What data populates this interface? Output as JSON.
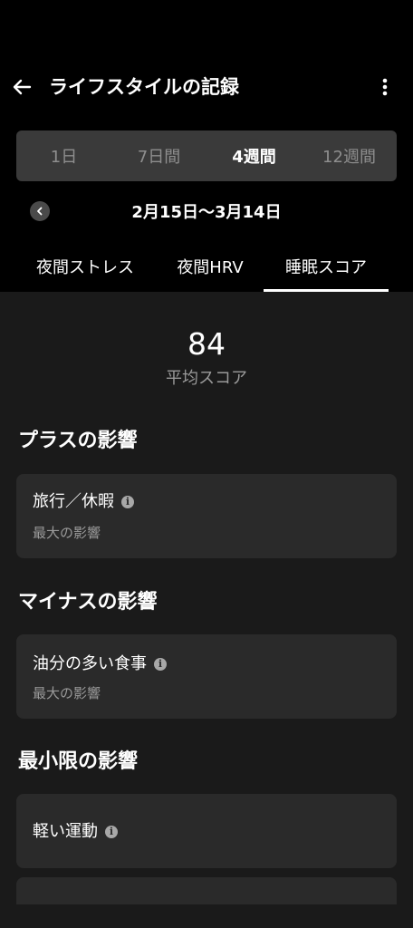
{
  "header": {
    "title": "ライフスタイルの記録",
    "back_icon": "arrow-left-icon",
    "more_icon": "more-vertical-icon"
  },
  "period_tabs": {
    "items": [
      {
        "label": "1日"
      },
      {
        "label": "7日間"
      },
      {
        "label": "4週間"
      },
      {
        "label": "12週間"
      }
    ],
    "selected": "4週間"
  },
  "date_nav": {
    "range": "2月15日〜3月14日",
    "prev_icon": "chevron-left-icon"
  },
  "metric_tabs": {
    "items": [
      {
        "label": "夜間ストレス"
      },
      {
        "label": "夜間HRV"
      },
      {
        "label": "睡眠スコア"
      }
    ],
    "selected": "睡眠スコア"
  },
  "score": {
    "value": "84",
    "label": "平均スコア"
  },
  "sections": [
    {
      "title": "プラスの影響",
      "cards": [
        {
          "title": "旅行／休暇",
          "subtitle": "最大の影響"
        }
      ]
    },
    {
      "title": "マイナスの影響",
      "cards": [
        {
          "title": "油分の多い食事",
          "subtitle": "最大の影響"
        }
      ]
    },
    {
      "title": "最小限の影響",
      "cards": [
        {
          "title": "軽い運動"
        }
      ]
    }
  ],
  "info_icon": "info-icon",
  "colors": {
    "background": "#000000",
    "panel": "#1a1a1a",
    "card": "#2a2a2a",
    "segment": "#3a3a3a",
    "muted_text": "#9a9a9a"
  }
}
